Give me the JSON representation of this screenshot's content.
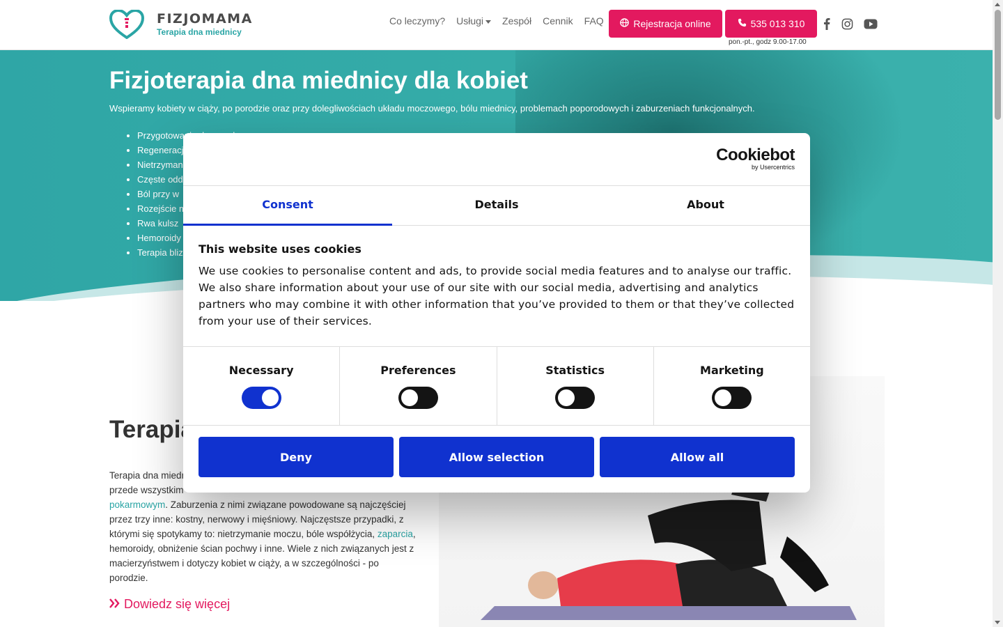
{
  "header": {
    "logo_name": "FIZJOMAMA",
    "logo_sub": "Terapia dna miednicy",
    "nav": [
      {
        "label": "Co leczymy?",
        "dropdown": false
      },
      {
        "label": "Usługi",
        "dropdown": true
      },
      {
        "label": "Zespół",
        "dropdown": false
      },
      {
        "label": "Cennik",
        "dropdown": false
      },
      {
        "label": "FAQ",
        "dropdown": false
      }
    ],
    "register_label": "Rejestracja online",
    "phone_label": "535 013 310",
    "hours": "pon.-pt., godz 9.00-17.00",
    "social": [
      "facebook-icon",
      "instagram-icon",
      "youtube-icon"
    ],
    "accent_color": "#e3195f",
    "brand_color": "#2aa5a5"
  },
  "hero": {
    "title": "Fizjoterapia dna miednicy dla kobiet",
    "description": "Wspieramy kobiety w ciąży, po porodzie oraz przy dolegliwościach układu moczowego, bólu miednicy, problemach poporodowych i zaburzeniach funkcjonalnych.",
    "list": [
      "Przygotowanie do porodu",
      "Regeneracja",
      "Nietrzymanie",
      "Częste odd",
      "Ból przy w",
      "Rozejście m",
      "Rwa kulsz",
      "Hemoroidy",
      "Terapia bliz"
    ]
  },
  "main": {
    "section_title": "Terapia",
    "paragraph_lines": [
      {
        "text": "Terapia dna miedn",
        "link": false
      },
      {
        "text": "przede wszystkim",
        "link": false
      }
    ],
    "paragraph_parts": [
      {
        "text": "pokarmowym",
        "link": true
      },
      {
        "text": ". Zaburzenia z nimi związane powodowane są najczęściej przez trzy inne: kostny, nerwowy i mięśniowy. Najczęstsze przypadki, z którymi się spotykamy to: nietrzymanie moczu, bóle współżycia, ",
        "link": false
      },
      {
        "text": "zaparcia",
        "link": true
      },
      {
        "text": ", hemoroidy, obniżenie ścian pochwy i inne. Wiele z nich związanych jest z macierzyństwem i dotyczy kobiet w ciąży, a w szczególności - po porodzie.",
        "link": false
      }
    ],
    "more_label": "Dowiedz się więcej"
  },
  "cookie": {
    "brand": "Cookiebot",
    "brand_sub": "by Usercentrics",
    "tabs": [
      {
        "label": "Consent",
        "active": true
      },
      {
        "label": "Details",
        "active": false
      },
      {
        "label": "About",
        "active": false
      }
    ],
    "heading": "This website uses cookies",
    "body": "We use cookies to personalise content and ads, to provide social media features and to analyse our traffic. We also share information about your use of our site with our social media, advertising and analytics partners who may combine it with other information that you’ve provided to them or that they’ve collected from your use of their services.",
    "toggles": [
      {
        "label": "Necessary",
        "on": true
      },
      {
        "label": "Preferences",
        "on": false
      },
      {
        "label": "Statistics",
        "on": false
      },
      {
        "label": "Marketing",
        "on": false
      }
    ],
    "buttons": {
      "deny": "Deny",
      "allow_selection": "Allow selection",
      "allow_all": "Allow all"
    },
    "accent_color": "#1032cf"
  }
}
